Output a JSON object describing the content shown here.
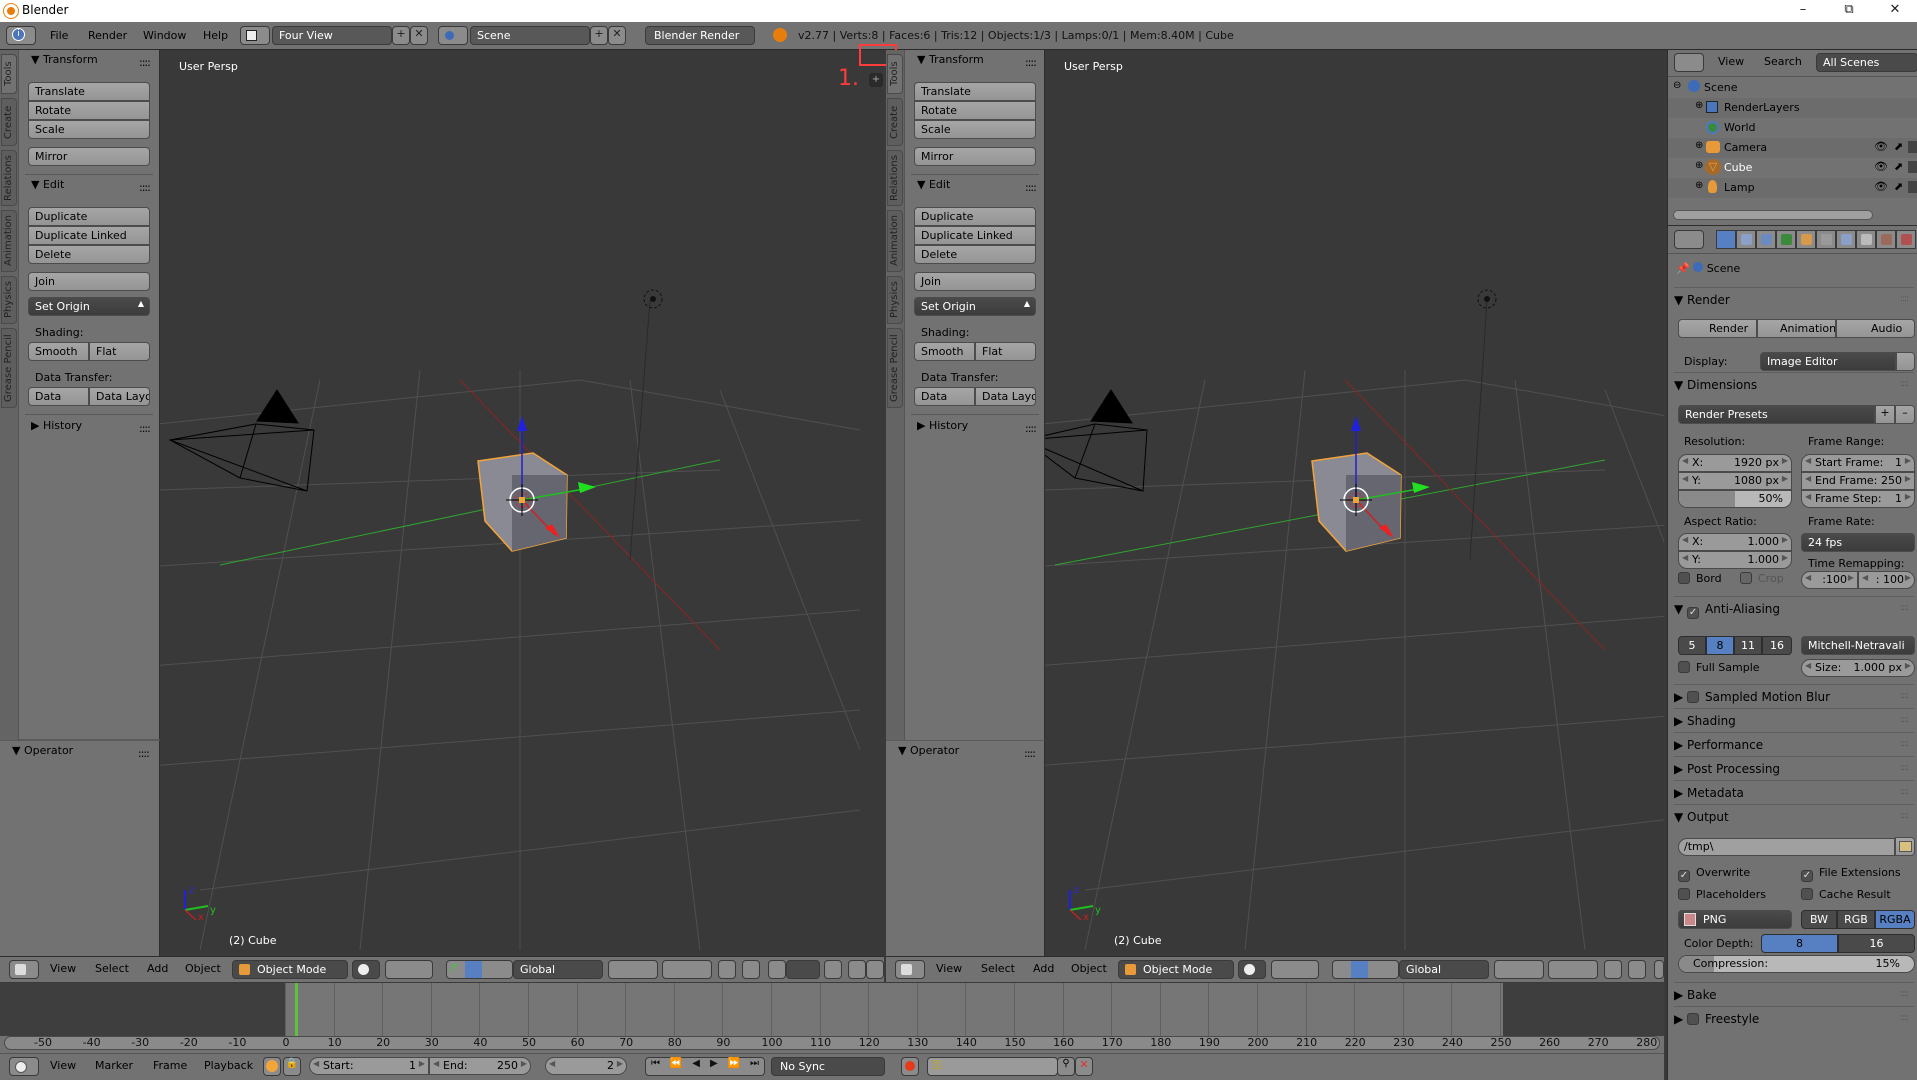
{
  "window": {
    "title": "Blender",
    "controls": [
      "minimize",
      "maximize",
      "close"
    ]
  },
  "top_header": {
    "menus": [
      "File",
      "Render",
      "Window",
      "Help"
    ],
    "screen_layout": "Four View",
    "scene": "Scene",
    "render_engine": "Blender Render",
    "stats": "v2.77 | Verts:8 | Faces:6 | Tris:12 | Objects:1/3 | Lamps:0/1 | Mem:8.40M | Cube"
  },
  "annotation": {
    "label": "1.",
    "color": "#ff3c3c"
  },
  "viewports": [
    {
      "id": "left",
      "view_label": "User Persp",
      "object_label": "(2) Cube",
      "axis_labels": {
        "x": "x",
        "y": "y",
        "z": "z"
      }
    },
    {
      "id": "right",
      "view_label": "User Persp",
      "object_label": "(2) Cube",
      "axis_labels": {
        "x": "x",
        "y": "y",
        "z": "z"
      }
    }
  ],
  "tool_shelf": {
    "tabs": [
      "Tools",
      "Create",
      "Relations",
      "Animation",
      "Physics",
      "Grease Pencil"
    ],
    "transform": {
      "title": "Transform",
      "buttons": [
        "Translate",
        "Rotate",
        "Scale"
      ],
      "mirror": "Mirror"
    },
    "edit": {
      "title": "Edit",
      "buttons": [
        "Duplicate",
        "Duplicate Linked",
        "Delete"
      ],
      "join": "Join",
      "set_origin": "Set Origin"
    },
    "shading": {
      "label": "Shading:",
      "smooth": "Smooth",
      "flat": "Flat"
    },
    "data_transfer": {
      "label": "Data Transfer:",
      "data": "Data",
      "data_layout": "Data Layo"
    },
    "history": "History",
    "operator": "Operator"
  },
  "view3d_header": {
    "menus": [
      "View",
      "Select",
      "Add",
      "Object"
    ],
    "mode": "Object Mode",
    "orientation": "Global"
  },
  "timeline": {
    "ticks": [
      -50,
      -40,
      -30,
      -20,
      -10,
      0,
      10,
      20,
      30,
      40,
      50,
      60,
      70,
      80,
      90,
      100,
      110,
      120,
      130,
      140,
      150,
      160,
      170,
      180,
      190,
      200,
      210,
      220,
      230,
      240,
      250,
      260,
      270,
      280
    ],
    "current_frame": 2,
    "menus": [
      "View",
      "Marker",
      "Frame",
      "Playback"
    ],
    "start_label": "Start:",
    "start": "1",
    "end_label": "End:",
    "end": "250",
    "frame": "2",
    "sync": "No Sync"
  },
  "outliner": {
    "menus": [
      "View",
      "Search"
    ],
    "filter": "All Scenes",
    "items": [
      {
        "name": "Scene",
        "level": 0
      },
      {
        "name": "RenderLayers",
        "level": 1
      },
      {
        "name": "World",
        "level": 1
      },
      {
        "name": "Camera",
        "level": 1
      },
      {
        "name": "Cube",
        "level": 1
      },
      {
        "name": "Lamp",
        "level": 1
      }
    ]
  },
  "properties": {
    "context": "Scene",
    "tabs": [
      "render",
      "render-layers",
      "scene",
      "world",
      "object",
      "constraints",
      "modifiers",
      "data",
      "material",
      "texture"
    ],
    "render": {
      "title": "Render",
      "buttons": [
        "Render",
        "Animation",
        "Audio"
      ],
      "display_label": "Display:",
      "display": "Image Editor"
    },
    "dimensions": {
      "title": "Dimensions",
      "presets": "Render Presets",
      "resolution_label": "Resolution:",
      "res_x_label": "X:",
      "res_x": "1920 px",
      "res_y_label": "Y:",
      "res_y": "1080 px",
      "res_percent": "50%",
      "res_percent_value": 0.5,
      "frame_range_label": "Frame Range:",
      "start_frame_label": "Start Frame:",
      "start_frame": "1",
      "end_frame_label": "End Frame:",
      "end_frame": "250",
      "frame_step_label": "Frame Step:",
      "frame_step": "1",
      "aspect_label": "Aspect Ratio:",
      "aspect_x_label": "X:",
      "aspect_x": "1.000",
      "aspect_y_label": "Y:",
      "aspect_y": "1.000",
      "frame_rate_label": "Frame Rate:",
      "frame_rate": "24 fps",
      "time_remap_label": "Time Remapping:",
      "remap_old": ":100",
      "remap_new": ": 100",
      "border": "Bord",
      "crop": "Crop"
    },
    "anti_aliasing": {
      "title": "Anti-Aliasing",
      "enabled": true,
      "samples": [
        "5",
        "8",
        "11",
        "16"
      ],
      "selected": "8",
      "filter": "Mitchell-Netravali",
      "full_sample": "Full Sample",
      "size_label": "Size:",
      "size": "1.000 px"
    },
    "collapsed_panels": [
      "Sampled Motion Blur",
      "Shading",
      "Performance",
      "Post Processing",
      "Metadata"
    ],
    "output": {
      "title": "Output",
      "path": "/tmp\\",
      "overwrite": "Overwrite",
      "overwrite_checked": true,
      "file_extensions": "File Extensions",
      "file_extensions_checked": true,
      "placeholders": "Placeholders",
      "placeholders_checked": false,
      "cache_result": "Cache Result",
      "cache_result_checked": false,
      "format": "PNG",
      "color_modes": [
        "BW",
        "RGB",
        "RGBA"
      ],
      "color_mode_selected": "RGBA",
      "color_depth_label": "Color Depth:",
      "color_depths": [
        "8",
        "16"
      ],
      "color_depth_selected": "8",
      "compression_label": "Compression:",
      "compression": "15%",
      "compression_value": 0.15
    },
    "bottom_panels": [
      "Bake",
      "Freestyle"
    ]
  },
  "colors": {
    "accent_blue": "#5680c2",
    "selection_orange": "#f3a43a",
    "viewport_bg": "#393939",
    "panel_bg": "#727272"
  }
}
